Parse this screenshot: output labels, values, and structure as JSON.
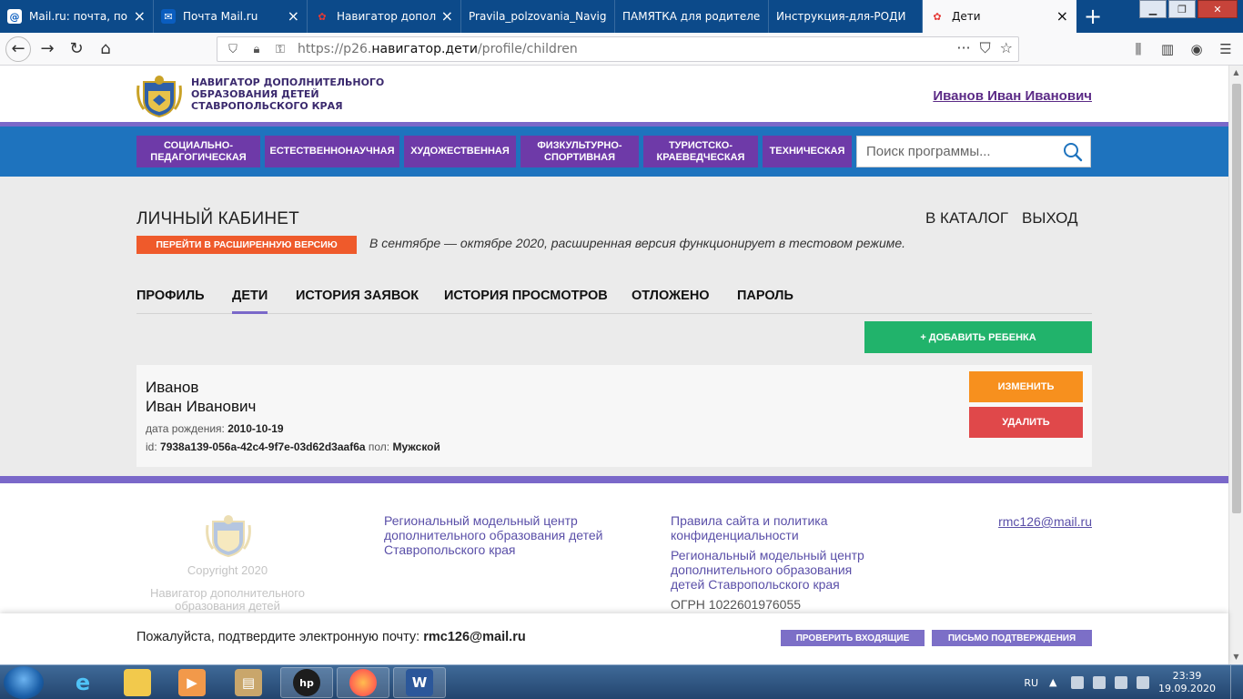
{
  "browser": {
    "tabs": [
      {
        "title": "Mail.ru: почта, поис",
        "favicon": "mailru-at-icon",
        "color": "#0a5dbf"
      },
      {
        "title": "Почта Mail.ru",
        "favicon": "envelope-icon",
        "color": "#0a5dbf"
      },
      {
        "title": "Навигатор дополни",
        "favicon": "navigator-flower-icon",
        "color": "#e53935"
      },
      {
        "title": "Pravila_polzovania_Navig",
        "favicon": "",
        "color": ""
      },
      {
        "title": "ПАМЯТКА для родителе",
        "favicon": "",
        "color": ""
      },
      {
        "title": "Инструкция-для-РОДИ",
        "favicon": "",
        "color": ""
      },
      {
        "title": "Дети",
        "favicon": "navigator-flower-icon",
        "color": "#e53935"
      }
    ],
    "url_prefix": "https://p26.",
    "url_domain": "навигатор.дети",
    "url_path": "/profile/children"
  },
  "header": {
    "logo_line1": "НАВИГАТОР ДОПОЛНИТЕЛЬНОГО",
    "logo_line2": "ОБРАЗОВАНИЯ ДЕТЕЙ",
    "logo_line3": "СТАВРОПОЛЬСКОГО КРАЯ",
    "user_name": "Иванов Иван Иванович"
  },
  "categories": [
    {
      "line1": "СОЦИАЛЬНО-",
      "line2": "ПЕДАГОГИЧЕСКАЯ"
    },
    {
      "line1": "ЕСТЕСТВЕННОНАУЧНАЯ",
      "line2": ""
    },
    {
      "line1": "ХУДОЖЕСТВЕННАЯ",
      "line2": ""
    },
    {
      "line1": "ФИЗКУЛЬТУРНО-",
      "line2": "СПОРТИВНАЯ"
    },
    {
      "line1": "ТУРИСТСКО-",
      "line2": "КРАЕВЕДЧЕСКАЯ"
    },
    {
      "line1": "ТЕХНИЧЕСКАЯ",
      "line2": ""
    }
  ],
  "search": {
    "placeholder": "Поиск программы..."
  },
  "cabinet": {
    "title": "ЛИЧНЫЙ КАБИНЕТ",
    "catalog_link": "В КАТАЛОГ",
    "logout_link": "ВЫХОД",
    "extended_button": "ПЕРЕЙТИ В РАСШИРЕННУЮ ВЕРСИЮ",
    "extended_note": "В сентябре — октябре 2020, расширенная версия функционирует в тестовом режиме."
  },
  "subnav": [
    "ПРОФИЛЬ",
    "ДЕТИ",
    "ИСТОРИЯ ЗАЯВОК",
    "ИСТОРИЯ ПРОСМОТРОВ",
    "ОТЛОЖЕНО",
    "ПАРОЛЬ"
  ],
  "subnav_active": "ДЕТИ",
  "add_child_button": "+ ДОБАВИТЬ РЕБЕНКА",
  "child": {
    "surname": "Иванов",
    "name": "Иван Иванович",
    "birth_label": "дата рождения:",
    "birth_date": "2010-10-19",
    "id_label": "id:",
    "id_value": "7938a139-056a-42c4-9f7e-03d62d3aaf6a",
    "gender_label": "пол:",
    "gender_value": "Мужской",
    "edit_button": "ИЗМЕНИТЬ",
    "delete_button": "УДАЛИТЬ"
  },
  "footer": {
    "copyright": "Copyright 2020",
    "nav_name_line1": "Навигатор дополнительного",
    "nav_name_line2": "образования детей",
    "col2_line1": "Региональный модельный центр",
    "col2_line2": "дополнительного образования детей",
    "col2_line3": "Ставропольского края",
    "rules_line1": "Правила сайта и политика",
    "rules_line2": "конфиденциальности",
    "col3_line1": "Региональный модельный центр",
    "col3_line2": "дополнительного образования",
    "col3_line3": "детей Ставропольского края",
    "ogrn": "ОГРН 1022601976055",
    "email": "rmc126@mail.ru"
  },
  "confirm_bar": {
    "text": "Пожалуйста, подтвердите электронную почту:",
    "email": "rmc126@mail.ru",
    "check_button": "ПРОВЕРИТЬ ВХОДЯЩИЕ",
    "letter_button": "ПИСЬМО ПОДТВЕРЖДЕНИЯ"
  },
  "taskbar": {
    "lang": "RU",
    "time": "23:39",
    "date": "19.09.2020",
    "apps": [
      "ie-icon",
      "explorer-icon",
      "media-player-icon",
      "printer-icon",
      "hp-icon",
      "firefox-icon",
      "word-icon"
    ]
  },
  "colors": {
    "brand_purple": "#6e3aa8",
    "accent_line": "#7a68c9",
    "blue_band": "#1e73be",
    "green": "#21b36b",
    "orange": "#f7901e",
    "red": "#e0484a",
    "extended_orange": "#ef5a2b"
  }
}
